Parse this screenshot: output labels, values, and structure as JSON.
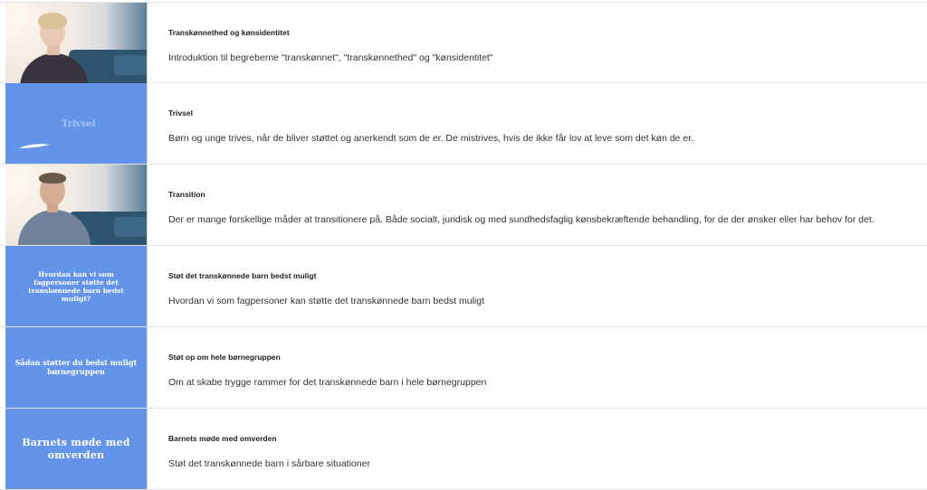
{
  "items": [
    {
      "title": "Transkønnethed og kønsidentitet",
      "description": "Introduktion til begreberne \"transkønnet\", \"transkønnethed\" og \"kønsidentitet\"",
      "thumbnail": {
        "kind": "photo",
        "subject": "woman-speaker"
      }
    },
    {
      "title": "Trivsel",
      "description": "Børn og unge trives, når de bliver støttet og anerkendt som de er. De mistrives, hvis de ikke får lov at leve som det køn de er.",
      "thumbnail": {
        "kind": "text",
        "text": "Trivsel"
      }
    },
    {
      "title": "Transition",
      "description": "Der er mange forskellige måder at transitionere på. Både socialt, juridisk og med sundhedsfaglig kønsbekræftende behandling, for de der ønsker eller har behov for det.",
      "thumbnail": {
        "kind": "photo",
        "subject": "man-speaker"
      }
    },
    {
      "title": "Støt det transkønnede barn bedst muligt",
      "description": "Hvordan vi som fagpersoner kan støtte det transkønnede barn bedst muligt",
      "thumbnail": {
        "kind": "text",
        "text": "Hvordan kan vi som fagpersoner støtte det transkønnede barn bedst muligt?"
      }
    },
    {
      "title": "Støt op om hele børnegruppen",
      "description": "Om at skabe trygge rammer for det transkønnede barn i hele børnegruppen",
      "thumbnail": {
        "kind": "text",
        "text": "Sådan støtter du bedst muligt børnegruppen"
      }
    },
    {
      "title": "Barnets møde med omverden",
      "description": "Støt det transkønnede barn i sårbare situationer",
      "thumbnail": {
        "kind": "text",
        "text": "Barnets møde med omverden"
      }
    }
  ],
  "colors": {
    "thumbnail_blue": "#6394ea",
    "divider": "#e2e2e2"
  }
}
